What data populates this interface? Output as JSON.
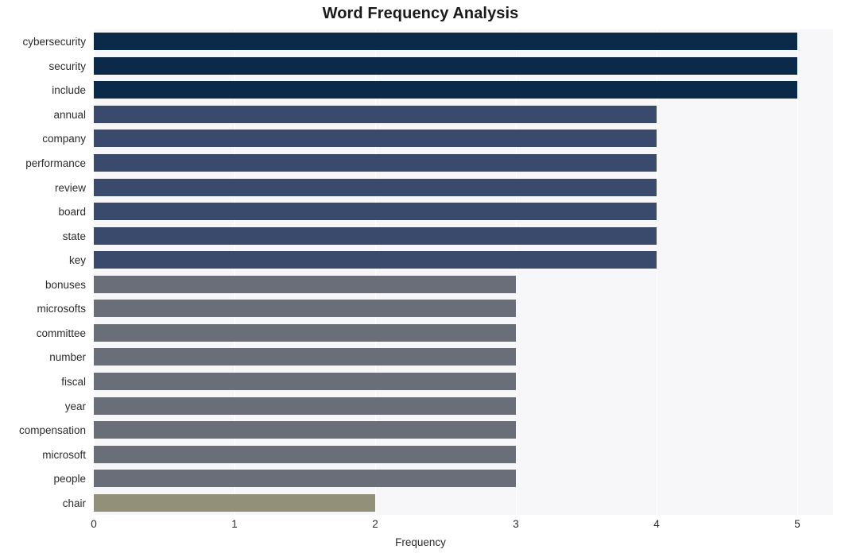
{
  "chart_data": {
    "type": "bar",
    "orientation": "horizontal",
    "title": "Word Frequency Analysis",
    "xlabel": "Frequency",
    "ylabel": "",
    "xlim": [
      0,
      5.25
    ],
    "ylim": [
      0,
      20
    ],
    "grid": true,
    "gridline_axis": "x",
    "legend": null,
    "xticks": [
      "0",
      "1",
      "2",
      "3",
      "4",
      "5"
    ],
    "xtick_values": [
      0,
      1,
      2,
      3,
      4,
      5
    ],
    "categories": [
      "cybersecurity",
      "security",
      "include",
      "annual",
      "company",
      "performance",
      "review",
      "board",
      "state",
      "key",
      "bonuses",
      "microsofts",
      "committee",
      "number",
      "fiscal",
      "year",
      "compensation",
      "microsoft",
      "people",
      "chair"
    ],
    "values": [
      5,
      5,
      5,
      4,
      4,
      4,
      4,
      4,
      4,
      4,
      3,
      3,
      3,
      3,
      3,
      3,
      3,
      3,
      3,
      2
    ],
    "bar_colors": [
      "#0b2949",
      "#0b2949",
      "#0b2949",
      "#394a6d",
      "#394a6d",
      "#394a6d",
      "#394a6d",
      "#394a6d",
      "#394a6d",
      "#394a6d",
      "#696e78",
      "#696e78",
      "#696e78",
      "#696e78",
      "#696e78",
      "#696e78",
      "#696e78",
      "#696e78",
      "#696e78",
      "#93907a"
    ]
  },
  "colors": {
    "plot_background": "#f7f7f9",
    "figure_background": "#ffffff",
    "gridline": "#ffffff",
    "text": "#2b2b2b",
    "title_text": "#1a1a1a"
  }
}
